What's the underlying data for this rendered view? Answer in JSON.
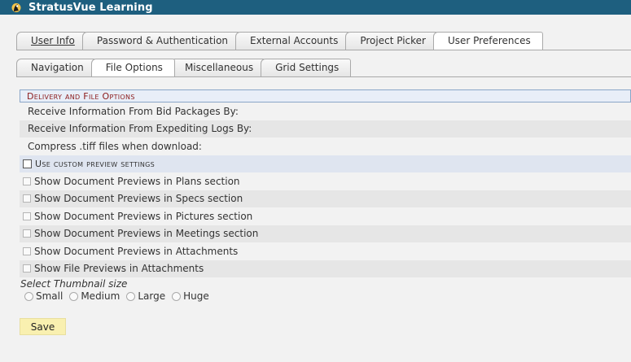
{
  "app": {
    "title": "StratusVue Learning",
    "logo_icon": "stratusvue-logo-icon"
  },
  "main_tabs": [
    {
      "label": "User Info",
      "active": false
    },
    {
      "label": "Password & Authentication",
      "active": false
    },
    {
      "label": "External Accounts",
      "active": false
    },
    {
      "label": "Project Picker",
      "active": false
    },
    {
      "label": "User Preferences",
      "active": true
    }
  ],
  "sub_tabs": [
    {
      "label": "Navigation",
      "active": false
    },
    {
      "label": "File Options",
      "active": true
    },
    {
      "label": "Miscellaneous",
      "active": false
    },
    {
      "label": "Grid Settings",
      "active": false
    }
  ],
  "section": {
    "header": "Delivery and File Options",
    "rows": [
      {
        "label": "Receive Information From Bid Packages By:"
      },
      {
        "label": "Receive Information From Expediting Logs By:"
      },
      {
        "label": "Compress .tiff files when download:"
      }
    ],
    "custom_preview": {
      "label": "Use custom preview settings",
      "checked": false
    },
    "preview_options": [
      {
        "label": "Show Document Previews in Plans section",
        "checked": false
      },
      {
        "label": "Show Document Previews in Specs section",
        "checked": false
      },
      {
        "label": "Show Document Previews in Pictures section",
        "checked": false
      },
      {
        "label": "Show Document Previews in Meetings section",
        "checked": false
      },
      {
        "label": "Show Document Previews in Attachments",
        "checked": false
      },
      {
        "label": "Show File Previews in Attachments",
        "checked": false
      }
    ]
  },
  "thumbnail": {
    "label": "Select Thumbnail size",
    "options": [
      "Small",
      "Medium",
      "Large",
      "Huge"
    ]
  },
  "save_label": "Save"
}
